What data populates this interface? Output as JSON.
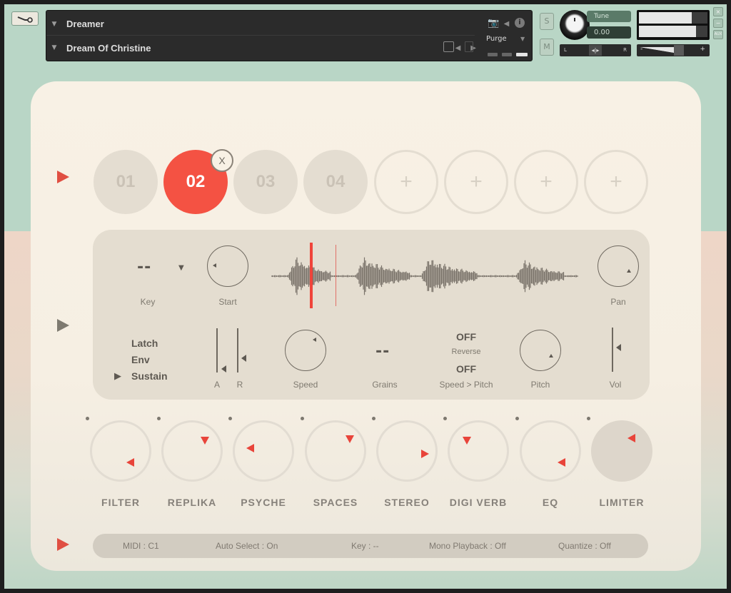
{
  "header": {
    "instrument_name": "Dreamer",
    "preset_name": "Dream Of Christine",
    "purge_label": "Purge",
    "solo_label": "S",
    "mute_label": "M",
    "tune_label": "Tune",
    "tune_value": "0.00",
    "pan_left": "L",
    "pan_right": "R",
    "vol_minus": "-",
    "vol_plus": "+",
    "window_buttons": [
      "×",
      "−",
      "AUX"
    ]
  },
  "slots": [
    {
      "label": "01",
      "state": "filled"
    },
    {
      "label": "02",
      "state": "active"
    },
    {
      "label": "03",
      "state": "filled"
    },
    {
      "label": "04",
      "state": "filled"
    },
    {
      "label": "+",
      "state": "empty"
    },
    {
      "label": "+",
      "state": "empty"
    },
    {
      "label": "+",
      "state": "empty"
    },
    {
      "label": "+",
      "state": "empty"
    }
  ],
  "slot_remove_label": "X",
  "editor": {
    "key_value": "--",
    "key_label": "Key",
    "start_label": "Start",
    "pan_label": "Pan",
    "modes": [
      "Latch",
      "Env",
      "Sustain"
    ],
    "selected_mode": "Sustain",
    "attack_label": "A",
    "release_label": "R",
    "speed_label": "Speed",
    "grains_value": "--",
    "grains_label": "Grains",
    "reverse_value": "OFF",
    "reverse_label": "Reverse",
    "speed_pitch_value": "OFF",
    "speed_pitch_label": "Speed > Pitch",
    "pitch_label": "Pitch",
    "vol_label": "Vol"
  },
  "effects": [
    {
      "label": "FILTER"
    },
    {
      "label": "REPLIKA"
    },
    {
      "label": "PSYCHE"
    },
    {
      "label": "SPACES"
    },
    {
      "label": "STEREO"
    },
    {
      "label": "DIGI VERB"
    },
    {
      "label": "EQ"
    },
    {
      "label": "LIMITER"
    }
  ],
  "status": {
    "midi": "MIDI : C1",
    "auto_select": "Auto Select : On",
    "key": "Key : --",
    "mono_playback": "Mono Playback : Off",
    "quantize": "Quantize : Off"
  },
  "colors": {
    "accent": "#f45243",
    "panel": "#f8f1e5",
    "editor_bg": "#e4ddd0"
  }
}
